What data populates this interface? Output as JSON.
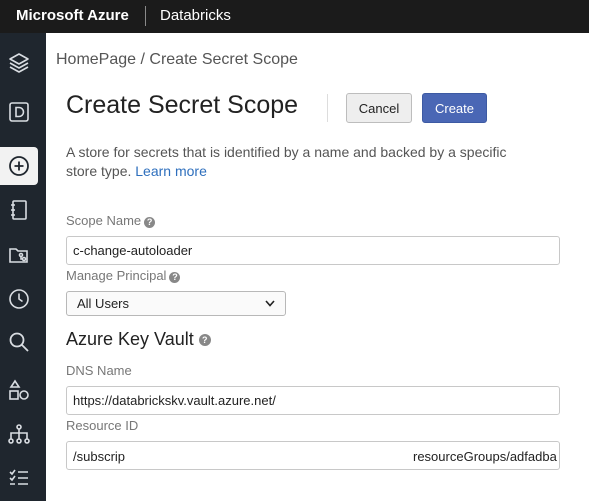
{
  "topbar": {
    "brand": "Microsoft Azure",
    "product": "Databricks"
  },
  "sidebar": {
    "items": [
      {
        "icon": "layers-icon"
      },
      {
        "icon": "workspace-d-icon"
      },
      {
        "icon": "create-plus-icon",
        "active": true
      },
      {
        "icon": "notebook-icon"
      },
      {
        "icon": "repos-icon"
      },
      {
        "icon": "recents-clock-icon"
      },
      {
        "icon": "search-icon"
      },
      {
        "icon": "shapes-icon"
      },
      {
        "icon": "network-icon"
      },
      {
        "icon": "tasks-list-icon"
      }
    ]
  },
  "breadcrumb": {
    "text": "HomePage / Create Secret Scope"
  },
  "page": {
    "title": "Create Secret Scope"
  },
  "actions": {
    "cancel_label": "Cancel",
    "create_label": "Create"
  },
  "description": {
    "text": "A store for secrets that is identified by a name and backed by a specific store type.",
    "link": "Learn more"
  },
  "form": {
    "scope_name": {
      "label": "Scope Name",
      "value": "c-change-autoloader"
    },
    "manage_principal": {
      "label": "Manage Principal",
      "value": "All Users"
    },
    "section_title": "Azure Key Vault",
    "dns_name": {
      "label": "DNS Name",
      "value": "https://databrickskv.vault.azure.net/"
    },
    "resource_id": {
      "label": "Resource ID",
      "value_start": "/subscrip",
      "value_end": "resourceGroups/adfadba"
    }
  },
  "colors": {
    "primary": "#4a67b5",
    "link": "#2e6fbd",
    "topbar": "#1b1b1b",
    "sidebar": "#1f262e"
  }
}
